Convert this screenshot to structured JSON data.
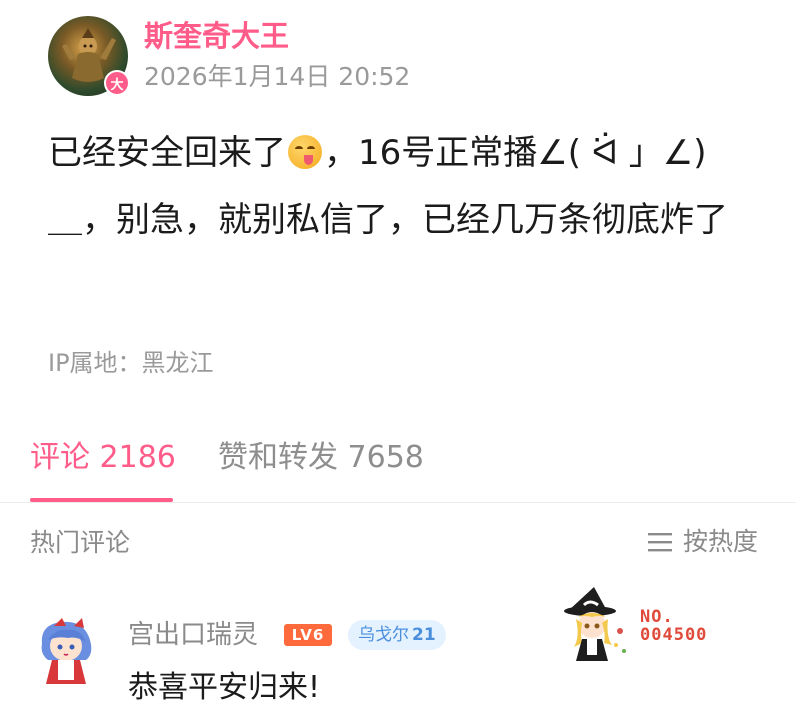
{
  "post": {
    "author": {
      "username": "斯奎奇大王",
      "badge": "大",
      "avatar_icon": "warrior-avatar"
    },
    "timestamp": "2026年1月14日 20:52",
    "content": {
      "text_before_emoji": "已经安全回来了",
      "emoji": "yum-face-emoji",
      "text_after_emoji": "，16号正常播∠( ᐛ 」∠)＿，别急，就别私信了，已经几万条彻底炸了"
    },
    "ip_location": "IP属地：黑龙江"
  },
  "tabs": {
    "comments": "评论 2186",
    "reposts": "赞和转发 7658",
    "active": "comments"
  },
  "hot_comments": {
    "title": "热门评论",
    "sort_label": "按热度",
    "sort_icon": "menu-lines-icon",
    "items": [
      {
        "username": "宫出口瑞灵",
        "level": "LV6",
        "fan_badge": {
          "name": "乌戈尔",
          "level": "21"
        },
        "text": "恭喜平安归来!",
        "decoration_number": "NO.\n004500"
      }
    ]
  },
  "colors": {
    "accent": "#ff5c8a",
    "muted": "#9a9a9a",
    "level_badge": "#ff6a3d",
    "fan_badge_bg": "#e4f1ff",
    "fan_badge_text": "#4b8fdc"
  }
}
